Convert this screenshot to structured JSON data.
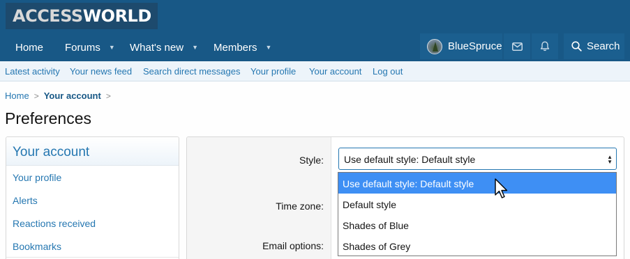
{
  "header": {
    "logo_part1": "ACCESS",
    "logo_part2": "WORLD"
  },
  "nav": {
    "items": [
      {
        "label": "Home",
        "has_caret": false
      },
      {
        "label": "Forums",
        "has_caret": true
      },
      {
        "label": "What's new",
        "has_caret": true
      },
      {
        "label": "Members",
        "has_caret": true
      }
    ],
    "user_name": "BlueSpruce",
    "search_label": "Search",
    "caret_glyph": "▼"
  },
  "sub_nav": {
    "links": [
      "Latest activity",
      "Your news feed",
      "Search direct messages",
      "Your profile",
      "Your account",
      "Log out"
    ]
  },
  "breadcrumb": {
    "home": "Home",
    "current": "Your account",
    "separator": ">"
  },
  "page_title": "Preferences",
  "sidebar": {
    "heading": "Your account",
    "items": [
      "Your profile",
      "Alerts",
      "Reactions received",
      "Bookmarks"
    ]
  },
  "form": {
    "style_label": "Style:",
    "timezone_label": "Time zone:",
    "email_label": "Email options:",
    "style_value": "Use default style: Default style",
    "style_options": [
      {
        "label": "Use default style: Default style",
        "selected": true
      },
      {
        "label": "Default style",
        "selected": false
      },
      {
        "label": "Shades of Blue",
        "selected": false
      },
      {
        "label": "Shades of Grey",
        "selected": false
      }
    ]
  },
  "colors": {
    "header_bg": "#185886",
    "link": "#2577b1",
    "selected_option": "#3e8ff4"
  },
  "icons": [
    "chevron-down-icon",
    "envelope-icon",
    "bell-icon",
    "search-icon",
    "select-arrows-icon",
    "mouse-cursor-icon"
  ]
}
